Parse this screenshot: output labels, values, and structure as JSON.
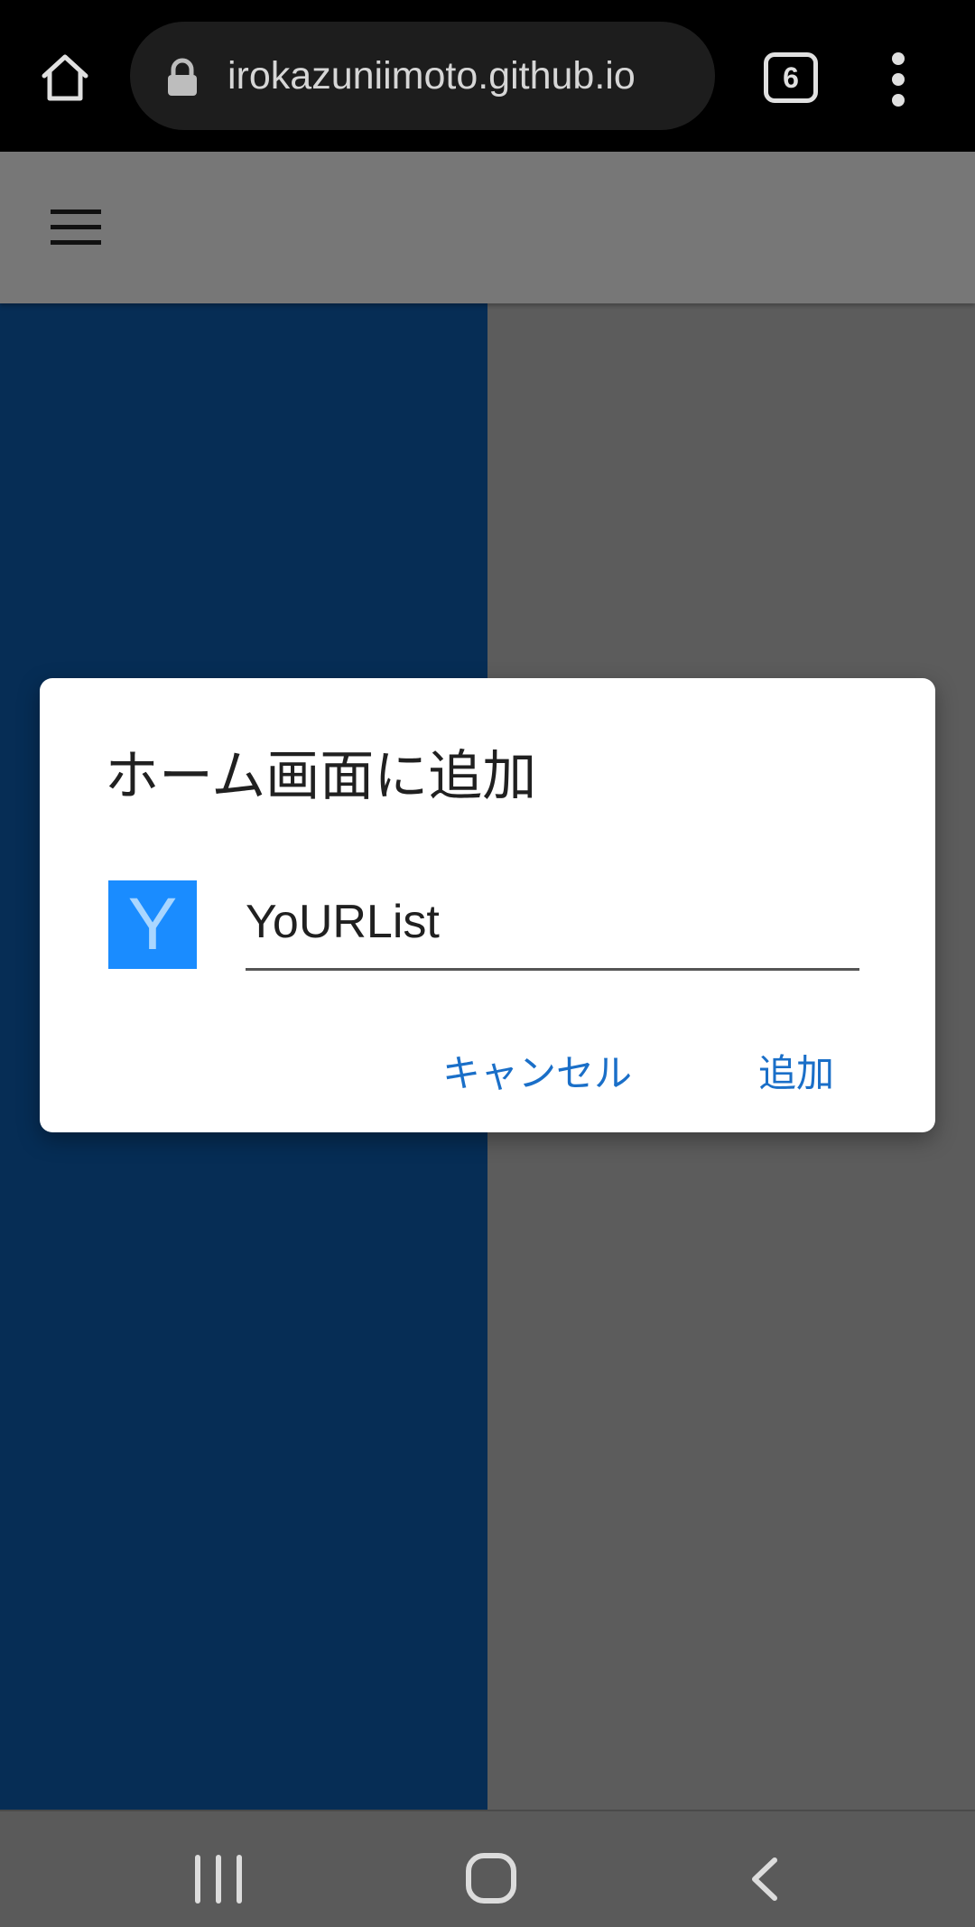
{
  "browser": {
    "url": "irokazuniimoto.github.io",
    "tab_count": "6",
    "icons": {
      "home": "home-icon",
      "lock": "lock-icon",
      "tabs": "tabs-counter-icon",
      "menu": "more-vert-icon"
    }
  },
  "page": {
    "app_bar": {
      "menu_icon": "hamburger-menu-icon"
    },
    "colors": {
      "drawer_panel": "#062d55",
      "scrim_gray": "#5c5c5c"
    }
  },
  "dialog": {
    "title": "ホーム画面に追加",
    "app_icon_letter": "Y",
    "app_icon_color": "#1a8cff",
    "name_value": "YoURList",
    "cancel_label": "キャンセル",
    "add_label": "追加",
    "button_color": "#1a6fc8"
  },
  "nav_bar": {
    "icons": {
      "recents": "recents-icon",
      "home": "home-circle-icon",
      "back": "back-chevron-icon"
    }
  }
}
